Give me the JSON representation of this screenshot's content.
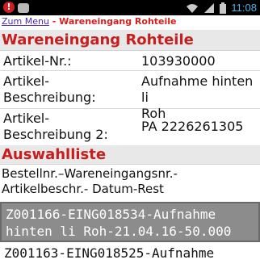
{
  "status_bar": {
    "time": "11:08",
    "left_icons": [
      "warning-icon",
      "android-icon"
    ],
    "right_icons": [
      "wifi-icon",
      "signal-icon",
      "battery-icon"
    ]
  },
  "breadcrumb": {
    "menu_label": "Zum Menu",
    "separator": " - ",
    "current": "Wareneingang Rohteile"
  },
  "detail": {
    "title": "Wareneingang Rohteile",
    "rows": [
      {
        "label": "Artikel-Nr.:",
        "value": "103930000"
      },
      {
        "label": "Artikel-\nBeschreibung:",
        "value": "Aufnahme hinten li\nRoh"
      },
      {
        "label": "Artikel-\nBeschreibung 2:",
        "value": "PA 2226261305"
      }
    ]
  },
  "selection": {
    "title": "Auswahlliste",
    "caption": "Bestellnr.–Wareneingangsnr.-\nArtikelbeschr.- Datum-Rest",
    "items": [
      {
        "text": "Z001166-EING018534-Aufnahme\nhinten li Roh-21.04.16-50.000",
        "selected": true
      },
      {
        "text": "Z001163-EING018525-Aufnahme",
        "selected": false
      }
    ]
  },
  "colors": {
    "header_text": "#c81e1e",
    "header_bg": "#e8e8e8",
    "link": "#4a2bb0",
    "selected_bg": "#8c8c8c",
    "clock": "#4fb3e8"
  }
}
